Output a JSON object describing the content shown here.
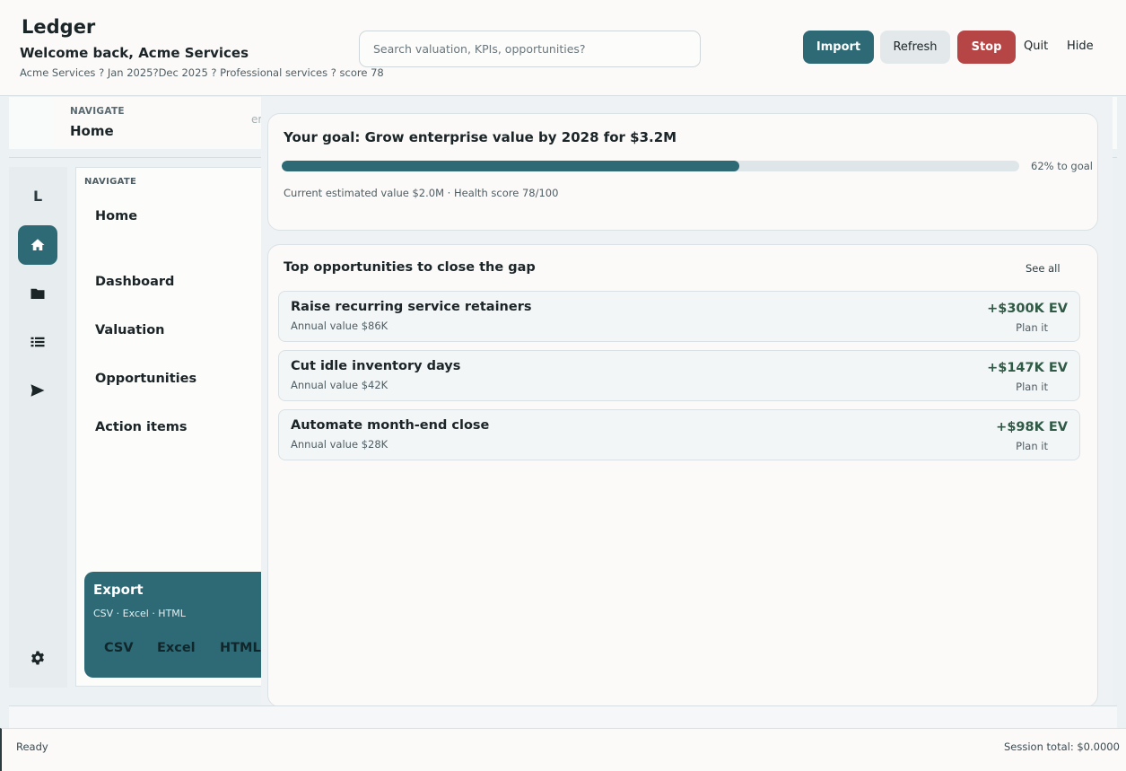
{
  "header": {
    "app_title": "Ledger",
    "welcome": "Welcome back, Acme Services",
    "meta": "Acme Services ? Jan 2025?Dec 2025 ? Professional services ? score 78",
    "search_placeholder": "Search valuation, KPIs, opportunities?",
    "buttons": {
      "import": "Import",
      "refresh": "Refresh",
      "stop": "Stop",
      "quit": "Quit",
      "hide": "Hide"
    }
  },
  "ghost": {
    "label": "NAVIGATE",
    "home": "Home",
    "fragment": "er"
  },
  "rail": {
    "letter": "L",
    "icons": [
      "home-icon",
      "folder-icon",
      "list-icon",
      "send-icon",
      "gear-icon"
    ],
    "active": "home-icon"
  },
  "nav": {
    "title": "NAVIGATE",
    "items": [
      "Home",
      "Dashboard",
      "Valuation",
      "Opportunities",
      "Action items"
    ]
  },
  "export": {
    "title": "Export",
    "subtitle": "CSV · Excel · HTML",
    "buttons": [
      "CSV",
      "Excel",
      "HTML"
    ]
  },
  "goal": {
    "title": "Your goal: Grow enterprise value by 2028 for $3.2M",
    "progress_percent": 62,
    "progress_label": "62% to goal",
    "subtitle": "Current estimated value $2.0M · Health score 78/100"
  },
  "opportunities": {
    "title": "Top opportunities to close the gap",
    "see_all": "See all",
    "items": [
      {
        "name": "Raise recurring service retainers",
        "annual": "Annual value $86K",
        "ev": "+$300K EV",
        "plan": "Plan it"
      },
      {
        "name": "Cut idle inventory days",
        "annual": "Annual value $42K",
        "ev": "+$147K EV",
        "plan": "Plan it"
      },
      {
        "name": "Automate month-end close",
        "annual": "Annual value $28K",
        "ev": "+$98K EV",
        "plan": "Plan it"
      }
    ]
  },
  "status": {
    "left": "Ready",
    "right": "Session total: $0.0000"
  },
  "colors": {
    "accent": "#2e6a75",
    "stop": "#b64646",
    "ev_green": "#2f5a45"
  }
}
